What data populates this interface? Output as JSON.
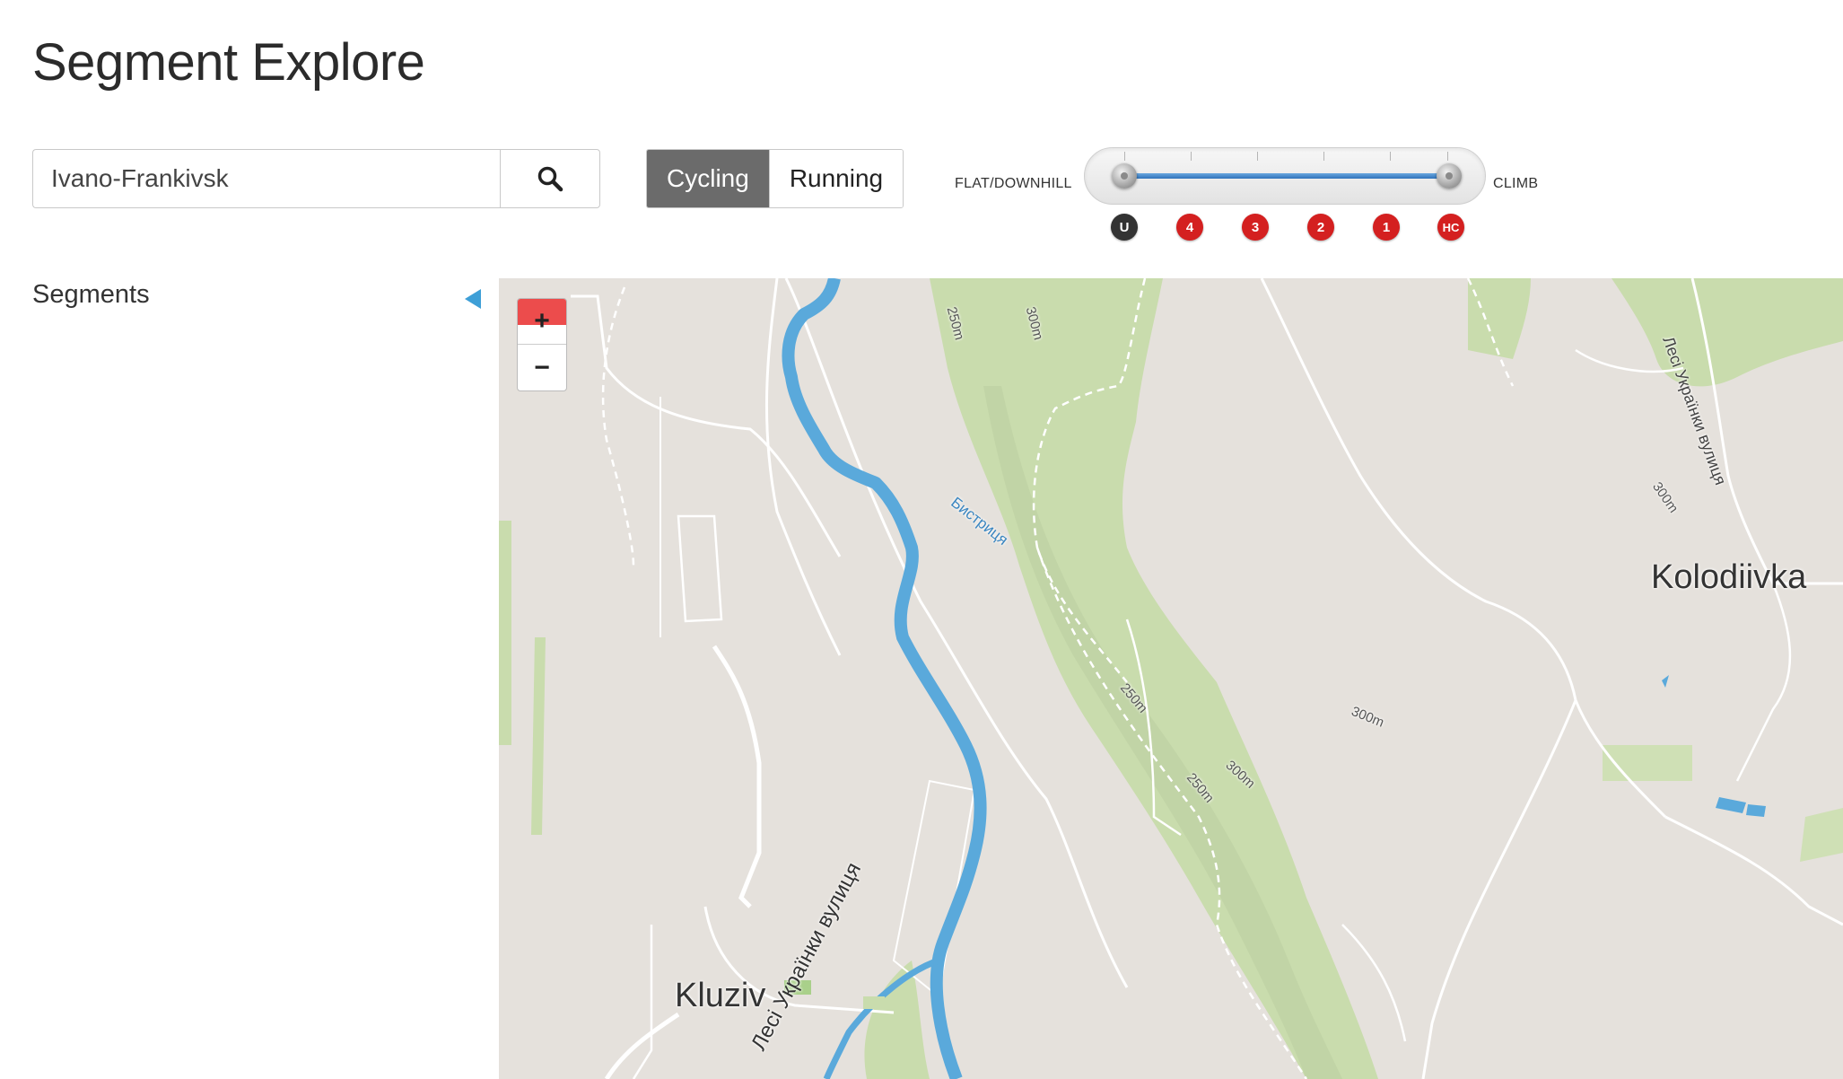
{
  "page": {
    "title": "Segment Explore"
  },
  "search": {
    "value": "Ivano-Frankivsk",
    "placeholder": ""
  },
  "sport_toggle": {
    "options": [
      "Cycling",
      "Running"
    ],
    "selected": "Cycling"
  },
  "climb_filter": {
    "left_label": "FLAT/DOWNHILL",
    "right_label": "CLIMB",
    "categories": [
      "U",
      "4",
      "3",
      "2",
      "1",
      "HC"
    ],
    "selected_range": [
      "U",
      "HC"
    ],
    "fill_color": "#2f73bb"
  },
  "sidebar": {
    "heading": "Segments",
    "collapse_icon": "triangle-left-icon"
  },
  "map": {
    "zoom_in_label": "+",
    "zoom_out_label": "−",
    "labels": {
      "town_kolodiivka": "Kolodiivka",
      "town_kluziv": "Kluziv",
      "river": "Бистриця",
      "street_top_right": "Лесі Українки вулиця",
      "street_bottom": "Лесі Українки вулиця",
      "contour_250_a": "250m",
      "contour_300_a": "300m",
      "contour_250_b": "250m",
      "contour_300_b": "300m",
      "contour_250_c": "250m",
      "contour_300_c": "300m",
      "contour_300_d": "300m"
    },
    "colors": {
      "land": "#e5e1dc",
      "forest": "#c9dcad",
      "water": "#5aa9db",
      "road": "#ffffff"
    }
  }
}
